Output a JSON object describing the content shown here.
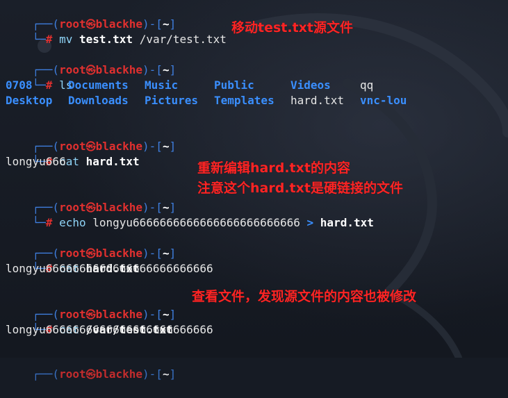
{
  "prompt": {
    "top_prefix": "┌──(",
    "user": "root",
    "skull": "㉿",
    "host": "blackhe",
    "mid": ")-[",
    "dir": "~",
    "close": "]",
    "bottom_prefix": "└─",
    "hash": "#"
  },
  "block1": {
    "cmd": "mv",
    "arg1": "test.txt",
    "arg2": "/var/test.txt"
  },
  "block2": {
    "cmd": "ls",
    "items_row1": [
      "0708",
      "Documents",
      "Music",
      "Public",
      "Videos",
      "qq"
    ],
    "items_row2": [
      "Desktop",
      "Downloads",
      "Pictures",
      "Templates",
      "hard.txt",
      "vnc-lou"
    ]
  },
  "block3": {
    "cmd": "cat",
    "arg": "hard.txt",
    "output": "longyu666"
  },
  "block4": {
    "cmd": "echo",
    "arg": "longyu6666666666666666666666666",
    "redirect": ">",
    "target": "hard.txt"
  },
  "block5": {
    "cmd": "cat",
    "arg": "hard.txt",
    "output": "longyu6666666666666666666666666"
  },
  "block6": {
    "cmd": "cat",
    "arg": "/var/test.txt",
    "output": "longyu6666666666666666666666666"
  },
  "annotations": {
    "note1": "移动test.txt源文件",
    "note2_line1": "重新编辑hard.txt的内容",
    "note2_line2": "注意这个hard.txt是硬链接的文件",
    "note3": "查看文件，发现源文件的内容也被修改"
  },
  "colors": {
    "background": "#161b24",
    "prompt_frame": "#3f7fe0",
    "prompt_user": "#e0302f",
    "command": "#8fd4f7",
    "directory": "#3a8fff",
    "annotation": "#ff2424"
  }
}
